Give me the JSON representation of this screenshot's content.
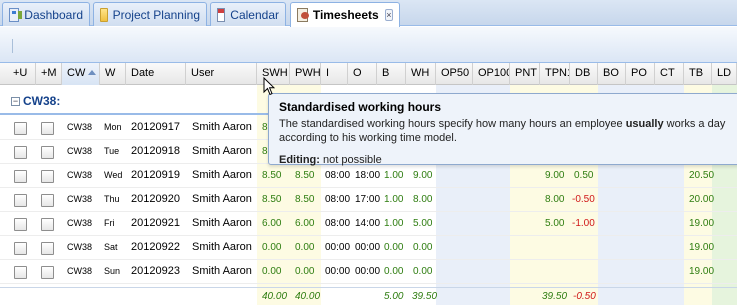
{
  "tabs": [
    {
      "label": "Dashboard",
      "icon": "dashboard-icon"
    },
    {
      "label": "Project Planning",
      "icon": "folder-icon"
    },
    {
      "label": "Calendar",
      "icon": "calendar-icon"
    },
    {
      "label": "Timesheets",
      "icon": "timesheet-icon",
      "active": true,
      "close": "×"
    }
  ],
  "grid": {
    "columns": [
      "+U",
      "+M",
      "CW",
      "W",
      "Date",
      "User",
      "SWH",
      "PWH",
      "I",
      "O",
      "B",
      "WH",
      "OP50",
      "OP100",
      "PNT",
      "TPN1",
      "DB",
      "BO",
      "PO",
      "CT",
      "TB",
      "LD"
    ],
    "sorted_column": "CW",
    "group": {
      "toggle": "−",
      "label": "CW38:"
    },
    "rows": [
      {
        "cw": "CW38",
        "w": "Mon",
        "date": "20120917",
        "user": "Smith Aaron",
        "swh": "8",
        "pwh": "",
        "i": "",
        "o": "",
        "b": "",
        "wh": "",
        "tpn1": "",
        "db": "",
        "tb": ""
      },
      {
        "cw": "CW38",
        "w": "Tue",
        "date": "20120918",
        "user": "Smith Aaron",
        "swh": "8",
        "pwh": "",
        "i": "",
        "o": "",
        "b": "",
        "wh": "",
        "tpn1": "",
        "db": "",
        "tb": ""
      },
      {
        "cw": "CW38",
        "w": "Wed",
        "date": "20120919",
        "user": "Smith Aaron",
        "swh": "8.50",
        "pwh": "8.50",
        "i": "08:00",
        "o": "18:00",
        "b": "1.00",
        "wh": "9.00",
        "tpn1": "9.00",
        "db": "0.50",
        "tb": "20.50"
      },
      {
        "cw": "CW38",
        "w": "Thu",
        "date": "20120920",
        "user": "Smith Aaron",
        "swh": "8.50",
        "pwh": "8.50",
        "i": "08:00",
        "o": "17:00",
        "b": "1.00",
        "wh": "8.00",
        "tpn1": "8.00",
        "db": "-0.50",
        "tb": "20.00"
      },
      {
        "cw": "CW38",
        "w": "Fri",
        "date": "20120921",
        "user": "Smith Aaron",
        "swh": "6.00",
        "pwh": "6.00",
        "i": "08:00",
        "o": "14:00",
        "b": "1.00",
        "wh": "5.00",
        "tpn1": "5.00",
        "db": "-1.00",
        "tb": "19.00"
      },
      {
        "cw": "CW38",
        "w": "Sat",
        "date": "20120922",
        "user": "Smith Aaron",
        "swh": "0.00",
        "pwh": "0.00",
        "i": "00:00",
        "o": "00:00",
        "b": "0.00",
        "wh": "0.00",
        "tpn1": "",
        "db": "",
        "tb": "19.00"
      },
      {
        "cw": "CW38",
        "w": "Sun",
        "date": "20120923",
        "user": "Smith Aaron",
        "swh": "0.00",
        "pwh": "0.00",
        "i": "00:00",
        "o": "00:00",
        "b": "0.00",
        "wh": "0.00",
        "tpn1": "",
        "db": "",
        "tb": "19.00"
      }
    ],
    "summary": {
      "swh": "40.00",
      "pwh": "40.00",
      "b": "5.00",
      "wh": "39.50",
      "tpn1": "39.50",
      "db": "-0.50"
    }
  },
  "tooltip": {
    "title": "Standardised working hours",
    "body_before": "The standardised working hours specify how many hours an employee ",
    "body_emphasis": "usually",
    "body_after": " works a day according to his working time model.",
    "footer_label": "Editing:",
    "footer_value": " not possible"
  },
  "colors": {
    "tab_text": "#15428b",
    "header_border": "#99bbe8",
    "positive": "#2e7d10",
    "negative": "#d01818",
    "tint_yellow": "#fdfbe3",
    "tint_blue": "#e9eff9",
    "tint_green": "#e6f4dd",
    "tooltip_bg": "#eef3fa"
  }
}
